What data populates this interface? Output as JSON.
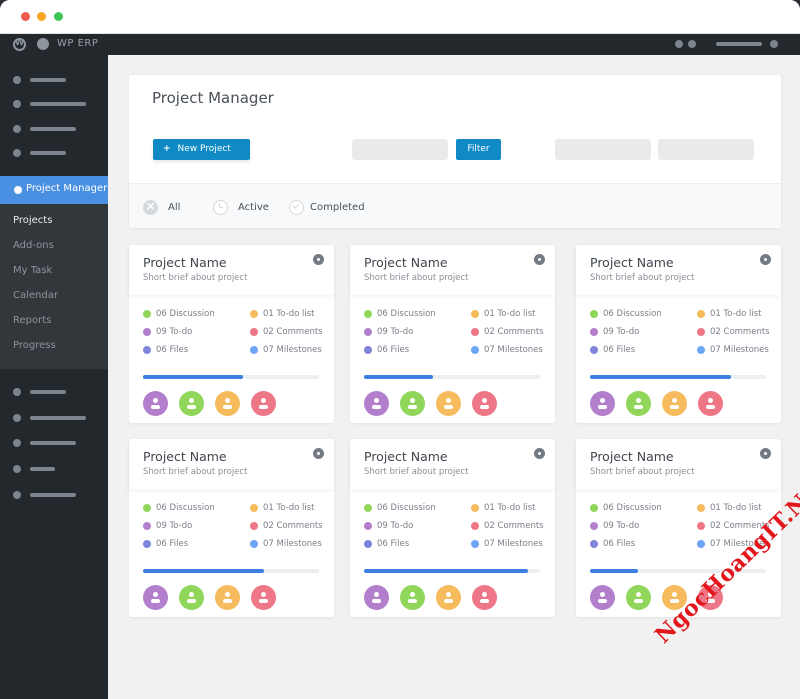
{
  "window": {
    "traffic_lights": {
      "close": "#ee5a52",
      "minimize": "#f5a623",
      "maximize": "#3fc556"
    }
  },
  "adminbar": {
    "app_name": "WP ERP"
  },
  "sidebar": {
    "active_item": "Project Manager",
    "sub_items": [
      {
        "label": "Projects",
        "current": true
      },
      {
        "label": "Add-ons",
        "current": false
      },
      {
        "label": "My Task",
        "current": false
      },
      {
        "label": "Calendar",
        "current": false
      },
      {
        "label": "Reports",
        "current": false
      },
      {
        "label": "Progress",
        "current": false
      }
    ]
  },
  "header": {
    "title": "Project Manager",
    "new_project_icon": "plus-icon",
    "new_project_label": "New Project",
    "filter_label": "Filter"
  },
  "tabs": [
    {
      "label": "All",
      "icon": "close-circle-icon"
    },
    {
      "label": "Active",
      "icon": "clock-icon"
    },
    {
      "label": "Completed",
      "icon": "check-circle-icon"
    }
  ],
  "colors": {
    "accent": "#0f8ac4",
    "sidebar_active": "#4a90e2",
    "progress": "#3b7fe0",
    "discussion": "#8fd65a",
    "todo": "#b37fcc",
    "files": "#7f86d9",
    "todo_list": "#f5bb5c",
    "comments": "#ee7787",
    "milestones": "#6ea6f5"
  },
  "projects": [
    {
      "name": "Project Name",
      "brief": "Short brief about project",
      "stats": {
        "discussion": "06 Discussion",
        "todo": "09 To-do",
        "files": "06 Files",
        "todo_list": "01 To-do list",
        "comments": "02 Comments",
        "milestones": "07 Milestones"
      },
      "progress": 57
    },
    {
      "name": "Project Name",
      "brief": "Short brief about project",
      "stats": {
        "discussion": "06 Discussion",
        "todo": "09 To-do",
        "files": "06 Files",
        "todo_list": "01 To-do list",
        "comments": "02 Comments",
        "milestones": "07 Milestones"
      },
      "progress": 39
    },
    {
      "name": "Project Name",
      "brief": "Short brief about project",
      "stats": {
        "discussion": "06 Discussion",
        "todo": "09 To-do",
        "files": "06 Files",
        "todo_list": "01 To-do list",
        "comments": "02 Comments",
        "milestones": "07 Milestones"
      },
      "progress": 80
    },
    {
      "name": "Project Name",
      "brief": "Short brief about project",
      "stats": {
        "discussion": "06 Discussion",
        "todo": "09 To-do",
        "files": "06 Files",
        "todo_list": "01 To-do list",
        "comments": "02 Comments",
        "milestones": "07 Milestones"
      },
      "progress": 69
    },
    {
      "name": "Project Name",
      "brief": "Short brief about project",
      "stats": {
        "discussion": "06 Discussion",
        "todo": "09 To-do",
        "files": "06 Files",
        "todo_list": "01 To-do list",
        "comments": "02 Comments",
        "milestones": "07 Milestones"
      },
      "progress": 93
    },
    {
      "name": "Project Name",
      "brief": "Short brief about project",
      "stats": {
        "discussion": "06 Discussion",
        "todo": "09 To-do",
        "files": "06 Files",
        "todo_list": "01 To-do list",
        "comments": "02 Comments",
        "milestones": "07 Milestones"
      },
      "progress": 27
    }
  ],
  "watermark": "NgocHoangIT.Net"
}
